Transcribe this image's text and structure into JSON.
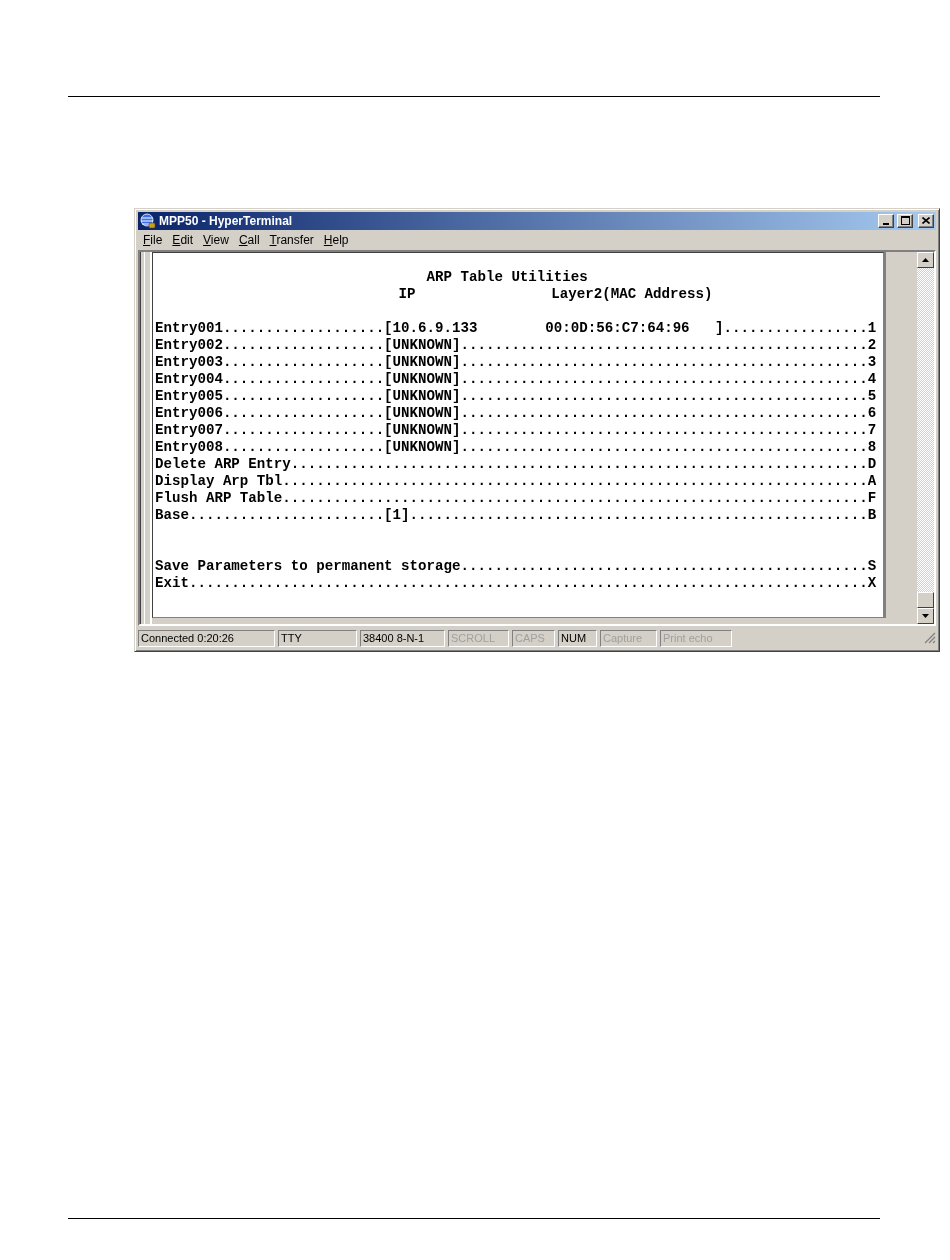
{
  "window": {
    "title": "MPP50 - HyperTerminal",
    "menu": [
      "File",
      "Edit",
      "View",
      "Call",
      "Transfer",
      "Help"
    ]
  },
  "terminal": {
    "title": "ARP Table Utilities",
    "columns": [
      "IP",
      "Layer2(MAC Address)"
    ],
    "blocks": [
      {
        "kind": "options",
        "lines": [
          "Entry001...................[10.6.9.133        00:0D:56:C7:64:96   ].................1",
          "Entry002...................[UNKNOWN]................................................2",
          "Entry003...................[UNKNOWN]................................................3",
          "Entry004...................[UNKNOWN]................................................4",
          "Entry005...................[UNKNOWN]................................................5",
          "Entry006...................[UNKNOWN]................................................6",
          "Entry007...................[UNKNOWN]................................................7",
          "Entry008...................[UNKNOWN]................................................8",
          "Delete ARP Entry....................................................................D",
          "Display Arp Tbl.....................................................................A",
          "Flush ARP Table.....................................................................F",
          "Base.......................[1]......................................................B"
        ]
      },
      {
        "kind": "footer",
        "lines": [
          "Save Parameters to permanent storage................................................S",
          "Exit................................................................................X"
        ]
      }
    ]
  },
  "status_bar": [
    {
      "text": "Connected 0:20:26",
      "disabled": false
    },
    {
      "text": "TTY",
      "disabled": false
    },
    {
      "text": "38400 8-N-1",
      "disabled": false
    },
    {
      "text": "SCROLL",
      "disabled": true
    },
    {
      "text": "CAPS",
      "disabled": true
    },
    {
      "text": "NUM",
      "disabled": false
    },
    {
      "text": "Capture",
      "disabled": true
    },
    {
      "text": "Print echo",
      "disabled": true
    }
  ]
}
